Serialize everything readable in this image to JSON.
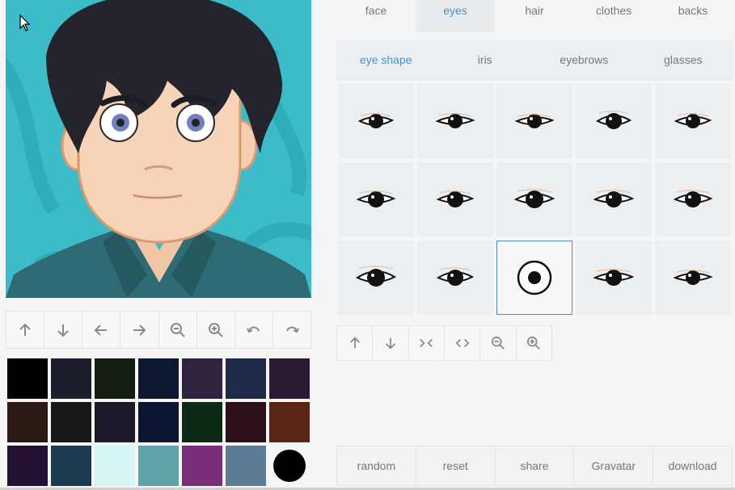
{
  "category_tabs": [
    {
      "label": "face",
      "active": false
    },
    {
      "label": "eyes",
      "active": true
    },
    {
      "label": "hair",
      "active": false
    },
    {
      "label": "clothes",
      "active": false
    },
    {
      "label": "backs",
      "active": false
    }
  ],
  "sub_tabs": [
    {
      "label": "eye shape",
      "active": true
    },
    {
      "label": "iris",
      "active": false
    },
    {
      "label": "eyebrows",
      "active": false
    },
    {
      "label": "glasses",
      "active": false
    }
  ],
  "eye_shapes": {
    "count": 15,
    "selected_index": 12
  },
  "left_toolbar": [
    "arrow-up-icon",
    "arrow-down-icon",
    "arrow-left-icon",
    "arrow-right-icon",
    "zoom-out-icon",
    "zoom-in-icon",
    "undo-icon",
    "redo-icon"
  ],
  "right_toolbar": [
    "arrow-up-icon",
    "arrow-down-icon",
    "move-closer-icon",
    "move-apart-icon",
    "zoom-out-icon",
    "zoom-in-icon"
  ],
  "palette": [
    "#000000",
    "#1b1f2c",
    "#141d12",
    "#0d1730",
    "#2f2340",
    "#1e2a48",
    "#2a1a33",
    "#2b1a14",
    "#171717",
    "#1b1a2b",
    "#0b1430",
    "#0d2b14",
    "#2d0f17",
    "#5a2515",
    "#241033",
    "#1a3b4f",
    "#d7f7f4",
    "#5fa3a8",
    "#7a2e7a",
    "#5b7c94",
    "selected-black"
  ],
  "actions": [
    {
      "label": "random"
    },
    {
      "label": "reset"
    },
    {
      "label": "share"
    },
    {
      "label": "Gravatar"
    },
    {
      "label": "download"
    }
  ]
}
